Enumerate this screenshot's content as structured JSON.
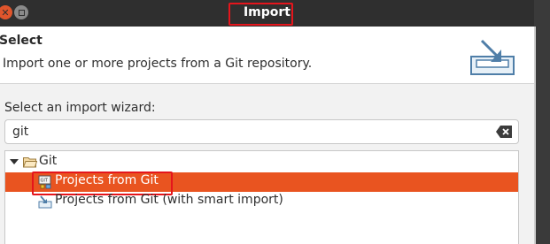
{
  "window": {
    "title": "Import",
    "close_label": "✕"
  },
  "header": {
    "title": "Select",
    "description": "Import one or more projects from a Git repository.",
    "icon": "import-wizard-icon"
  },
  "wizard": {
    "label": "Select an import wizard:",
    "filter_value": "git",
    "clear_icon": "clear-text-icon"
  },
  "tree": {
    "category": {
      "label": "Git",
      "expanded": true,
      "icon": "folder-open-icon"
    },
    "items": [
      {
        "label": "Projects from Git",
        "selected": true,
        "icon": "git-repository-icon"
      },
      {
        "label": "Projects from Git (with smart import)",
        "selected": false,
        "icon": "smart-import-icon"
      }
    ]
  },
  "colors": {
    "titlebar": "#2f2f2f",
    "selection": "#e95420",
    "highlight_box": "#e5151c",
    "body_background": "#f2f2f2"
  }
}
